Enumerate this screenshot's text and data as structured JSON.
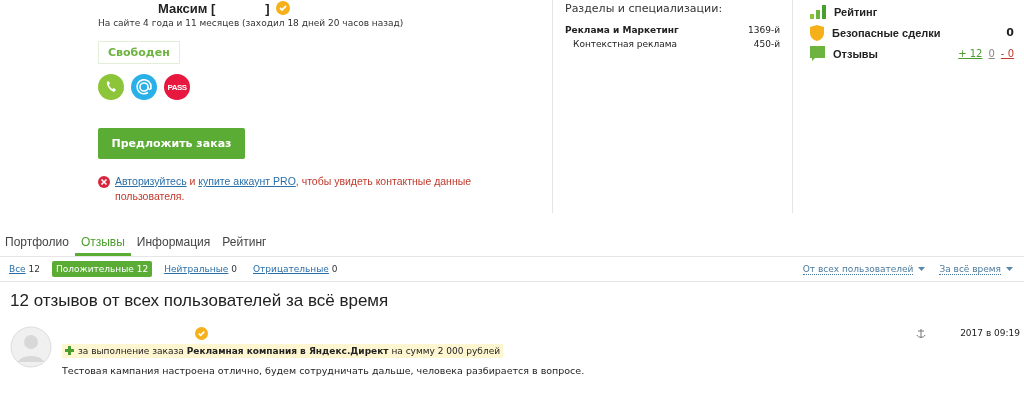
{
  "profile": {
    "name": "Максим [",
    "name_end": "]",
    "verified": true,
    "since": "На сайте 4 года и 11 месяцев (заходил 18 дней 20 часов назад)",
    "status": "Свободен",
    "contacts": [
      {
        "kind": "phone",
        "color": "#8cc43a"
      },
      {
        "kind": "email",
        "color": "#29b0e8"
      },
      {
        "kind": "pass",
        "label": "PASS",
        "color": "#e8173f"
      }
    ],
    "order_button": "Предложить заказ",
    "notice": [
      {
        "kind": "link",
        "text": "Авторизуйтесь"
      },
      {
        "kind": "text",
        "text": " и "
      },
      {
        "kind": "link",
        "text": "купите аккаунт PRO"
      },
      {
        "kind": "text",
        "text": ", чтобы увидеть контактные данные пользователя."
      }
    ]
  },
  "specializations": {
    "title": "Разделы и специализации:",
    "items": [
      {
        "name": "Реклама и Маркетинг",
        "place": "1369-й",
        "main": true
      },
      {
        "name": "Контекстная реклама",
        "place": "450-й",
        "main": false
      }
    ]
  },
  "stats": [
    {
      "kind": "rating",
      "label": "Рейтинг"
    },
    {
      "kind": "deals",
      "label": "Безопасные сделки",
      "value": "0"
    },
    {
      "kind": "reviews",
      "label": "Отзывы",
      "positive": "+ 12",
      "neutral": "0",
      "negative": "- 0"
    }
  ],
  "tabs": [
    {
      "label": "Портфолио",
      "selected": false
    },
    {
      "label": "Отзывы",
      "selected": true
    },
    {
      "label": "Информация",
      "selected": false
    },
    {
      "label": "Рейтинг",
      "selected": false
    }
  ],
  "filters": [
    {
      "label": "Все",
      "count": "12",
      "selected": false
    },
    {
      "label": "Положительные",
      "count": "12",
      "selected": true
    },
    {
      "label": "Нейтральные",
      "count": "0",
      "selected": false
    },
    {
      "label": "Отрицательные",
      "count": "0",
      "selected": false
    }
  ],
  "dropdowns": [
    "От всех пользователей",
    "За всё время"
  ],
  "heading": "12 отзывов от всех пользователей за всё время",
  "reviews": [
    {
      "verified": true,
      "order_prefix": "за выполнение заказа",
      "order": "Рекламная компания в Яндекс.Директ",
      "order_suffix": "на сумму 2 000 рублей",
      "date": "2017 в 09:19",
      "text": "Тестовая кампания настроена отлично, будем сотрудничать дальше, человека разбирается в вопросе."
    }
  ]
}
